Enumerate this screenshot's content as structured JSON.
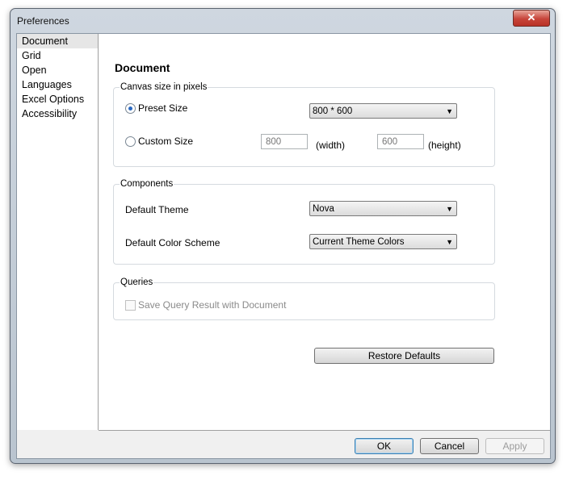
{
  "window": {
    "title": "Preferences",
    "close_label": "✕"
  },
  "sidebar": {
    "items": [
      {
        "label": "Document"
      },
      {
        "label": "Grid"
      },
      {
        "label": "Open"
      },
      {
        "label": "Languages"
      },
      {
        "label": "Excel Options"
      },
      {
        "label": "Accessibility"
      }
    ]
  },
  "main": {
    "heading": "Document",
    "canvas": {
      "label": "Canvas size in pixels",
      "preset_label": "Preset Size",
      "preset_value": "800 * 600",
      "custom_label": "Custom Size",
      "width_value": "800",
      "width_unit": "(width)",
      "height_value": "600",
      "height_unit": "(height)"
    },
    "components": {
      "label": "Components",
      "theme_label": "Default Theme",
      "theme_value": "Nova",
      "scheme_label": "Default Color Scheme",
      "scheme_value": "Current Theme Colors"
    },
    "queries": {
      "label": "Queries",
      "save_label": "Save Query Result with Document"
    },
    "restore_label": "Restore Defaults"
  },
  "footer": {
    "ok_label": "OK",
    "cancel_label": "Cancel",
    "apply_label": "Apply"
  }
}
